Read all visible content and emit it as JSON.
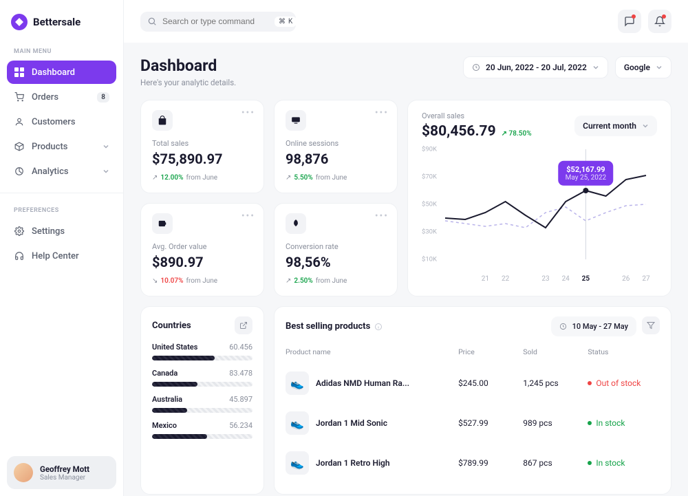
{
  "brand": "Bettersale",
  "search": {
    "placeholder": "Search or type command",
    "kbd_mod": "⌘",
    "kbd_key": "K"
  },
  "sidebar": {
    "main_menu_label": "MAIN MENU",
    "preferences_label": "PREFERENCES",
    "items": [
      {
        "label": "Dashboard",
        "active": true
      },
      {
        "label": "Orders",
        "badge": "8"
      },
      {
        "label": "Customers"
      },
      {
        "label": "Products",
        "chevron": true
      },
      {
        "label": "Analytics",
        "chevron": true
      }
    ],
    "pref_items": [
      {
        "label": "Settings"
      },
      {
        "label": "Help Center"
      }
    ]
  },
  "user": {
    "name": "Geoffrey Mott",
    "role": "Sales Manager"
  },
  "page": {
    "title": "Dashboard",
    "subtitle": "Here's your analytic details."
  },
  "head_controls": {
    "date_range": "20 Jun, 2022 - 20 Jul, 2022",
    "source": "Google"
  },
  "stats": [
    {
      "label": "Total sales",
      "value": "$75,890.97",
      "delta": "12.00%",
      "from": "from June",
      "dir": "up",
      "icon": "bag-icon"
    },
    {
      "label": "Online sessions",
      "value": "98,876",
      "delta": "5.50%",
      "from": "from June",
      "dir": "up",
      "icon": "monitor-icon"
    },
    {
      "label": "Avg. Order value",
      "value": "$890.97",
      "delta": "10.07%",
      "from": "from June",
      "dir": "down",
      "icon": "wallet-icon"
    },
    {
      "label": "Conversion rate",
      "value": "98,56%",
      "delta": "2.50%",
      "from": "from June",
      "dir": "up",
      "icon": "rocket-icon"
    }
  ],
  "chart": {
    "label": "Overall sales",
    "value": "$80,456.79",
    "delta": "78.50%",
    "range_label": "Current month",
    "tooltip_value": "$52,167.99",
    "tooltip_date": "May 25, 2022"
  },
  "chart_data": {
    "type": "line",
    "xlabel": "",
    "ylabel": "",
    "ylim": [
      10000,
      90000
    ],
    "y_ticks": [
      "$90K",
      "$70K",
      "$50K",
      "$30K",
      "$10K"
    ],
    "categories": [
      "21",
      "22",
      "23",
      "24",
      "25",
      "26",
      "27"
    ],
    "active_category": "25",
    "series": [
      {
        "name": "primary",
        "values": [
          40000,
          39000,
          44000,
          52000,
          42000,
          33000,
          52000,
          60000,
          56000,
          68000,
          71000
        ]
      },
      {
        "name": "secondary",
        "values": [
          38000,
          36000,
          34000,
          36000,
          33000,
          44000,
          48000,
          38000,
          44000,
          49000,
          50000
        ]
      }
    ]
  },
  "countries": {
    "title": "Countries",
    "rows": [
      {
        "name": "United States",
        "value": "60.456",
        "pct": 62
      },
      {
        "name": "Canada",
        "value": "83.478",
        "pct": 45
      },
      {
        "name": "Australia",
        "value": "45.897",
        "pct": 35
      },
      {
        "name": "Mexico",
        "value": "56.234",
        "pct": 55
      }
    ]
  },
  "products": {
    "title": "Best selling products",
    "date_range": "10 May - 27 May",
    "columns": {
      "name": "Product name",
      "price": "Price",
      "sold": "Sold",
      "status": "Status"
    },
    "rows": [
      {
        "name": "Adidas NMD Human Ra...",
        "price": "$245.00",
        "sold": "1,245 pcs",
        "status": "Out of stock",
        "status_kind": "out",
        "emoji": "👟"
      },
      {
        "name": "Jordan 1 Mid Sonic",
        "price": "$527.99",
        "sold": "989 pcs",
        "status": "In stock",
        "status_kind": "in",
        "emoji": "👟"
      },
      {
        "name": "Jordan 1 Retro High",
        "price": "$789.99",
        "sold": "867 pcs",
        "status": "In stock",
        "status_kind": "in",
        "emoji": "👟"
      }
    ]
  }
}
